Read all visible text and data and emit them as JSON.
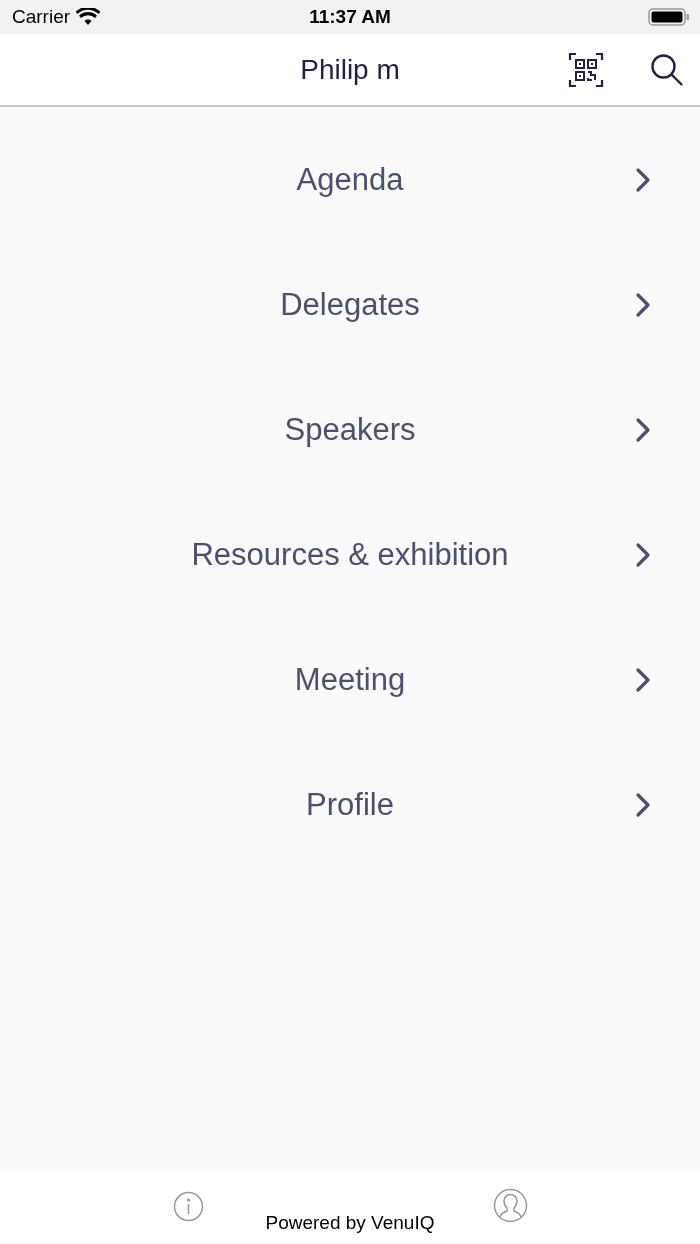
{
  "status_bar": {
    "carrier": "Carrier",
    "time": "11:37 AM"
  },
  "nav": {
    "title": "Philip m"
  },
  "menu": [
    {
      "label": "Agenda"
    },
    {
      "label": "Delegates"
    },
    {
      "label": "Speakers"
    },
    {
      "label": "Resources & exhibition"
    },
    {
      "label": "Meeting"
    },
    {
      "label": "Profile"
    }
  ],
  "footer": {
    "text": "Powered by VenuIQ"
  }
}
